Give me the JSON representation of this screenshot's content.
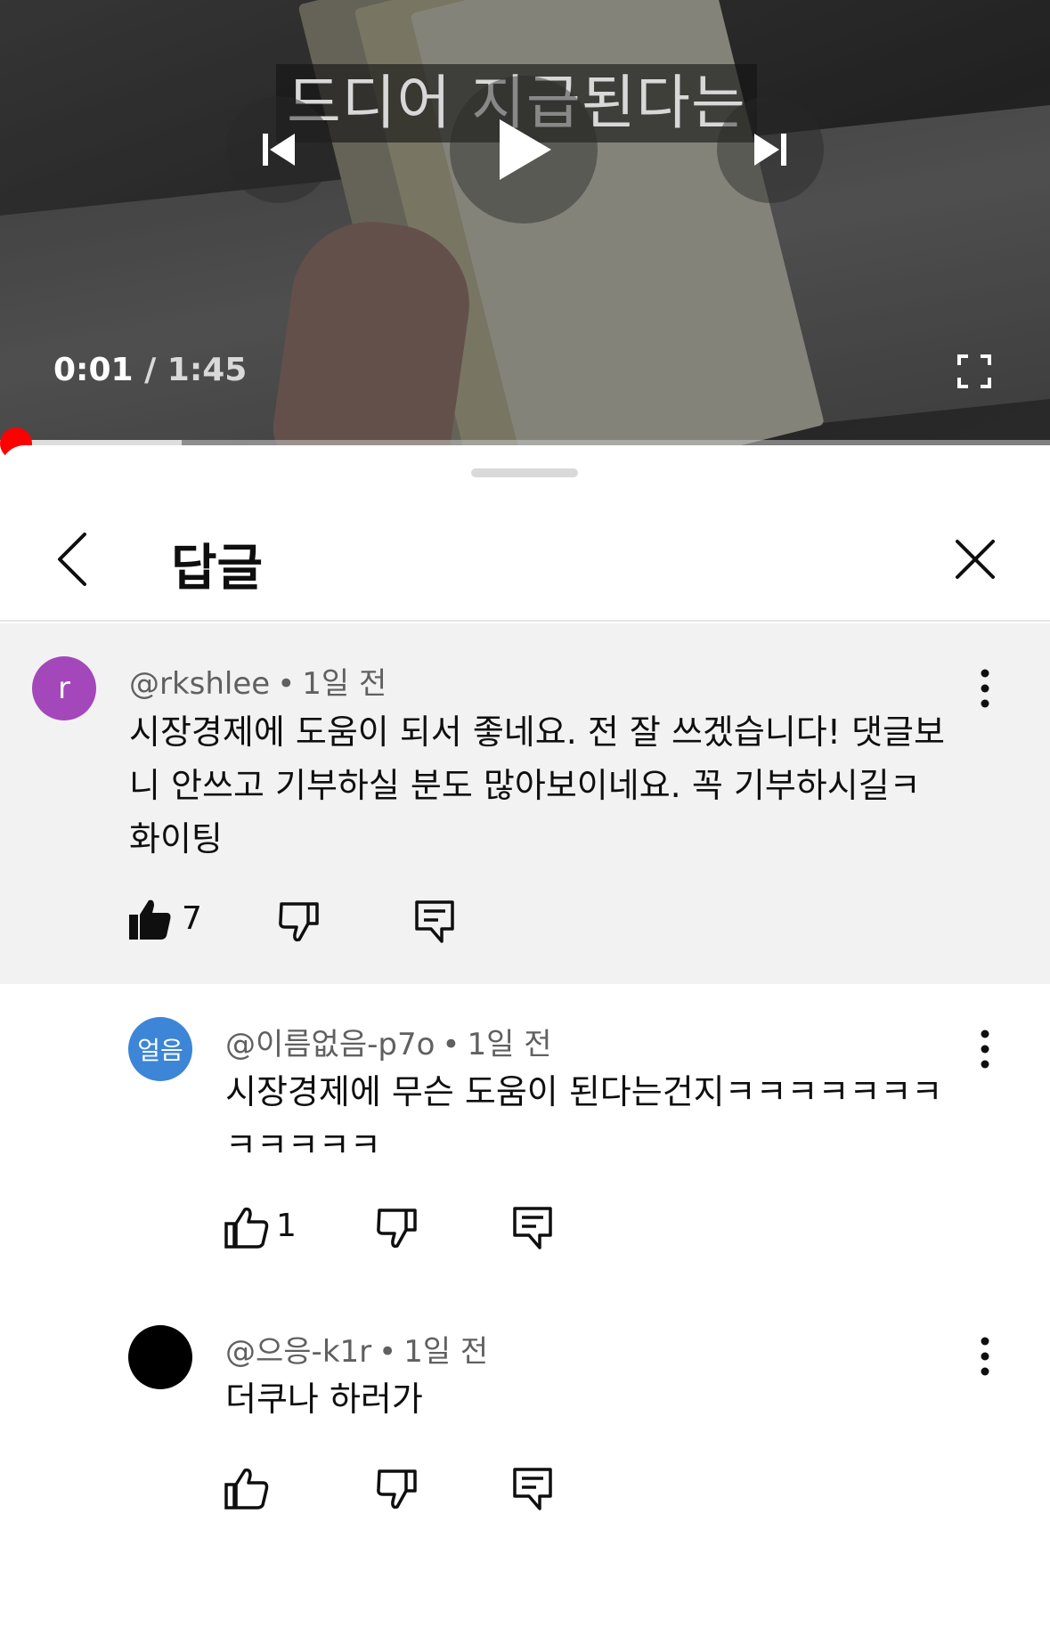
{
  "player": {
    "caption": "드디어 지급된다는",
    "current_time": "0:01",
    "separator": " / ",
    "duration": "1:45",
    "progress_fraction": 0.01,
    "accent_color": "#ff0000"
  },
  "panel": {
    "title": "답글"
  },
  "comments": [
    {
      "avatar_letter": "r",
      "avatar_color": "#a347ba",
      "handle": "@rkshlee",
      "age": "1일 전",
      "lines": [
        "시장경제에 도움이 되서 좋네요. 전 잘 쓰겠습니다! 댓글보",
        "니 안쓰고 기부하실 분도 많아보이네요. 꼭 기부하시길ㅋ",
        "화이팅"
      ],
      "likes": "7",
      "liked": true
    },
    {
      "avatar_letter": "얼음",
      "avatar_color": "#3d85d6",
      "handle": "@이름없음-p7o",
      "age": "1일 전",
      "lines": [
        "시장경제에 무슨 도움이 된다는건지ㅋㅋㅋㅋㅋㅋㅋ",
        "ㅋㅋㅋㅋㅋ"
      ],
      "likes": "1"
    },
    {
      "avatar_letter": "",
      "avatar_color": "#000000",
      "handle": "@으응-k1r",
      "age": "1일 전",
      "lines": [
        "더쿠나 하러가"
      ],
      "likes": ""
    }
  ]
}
